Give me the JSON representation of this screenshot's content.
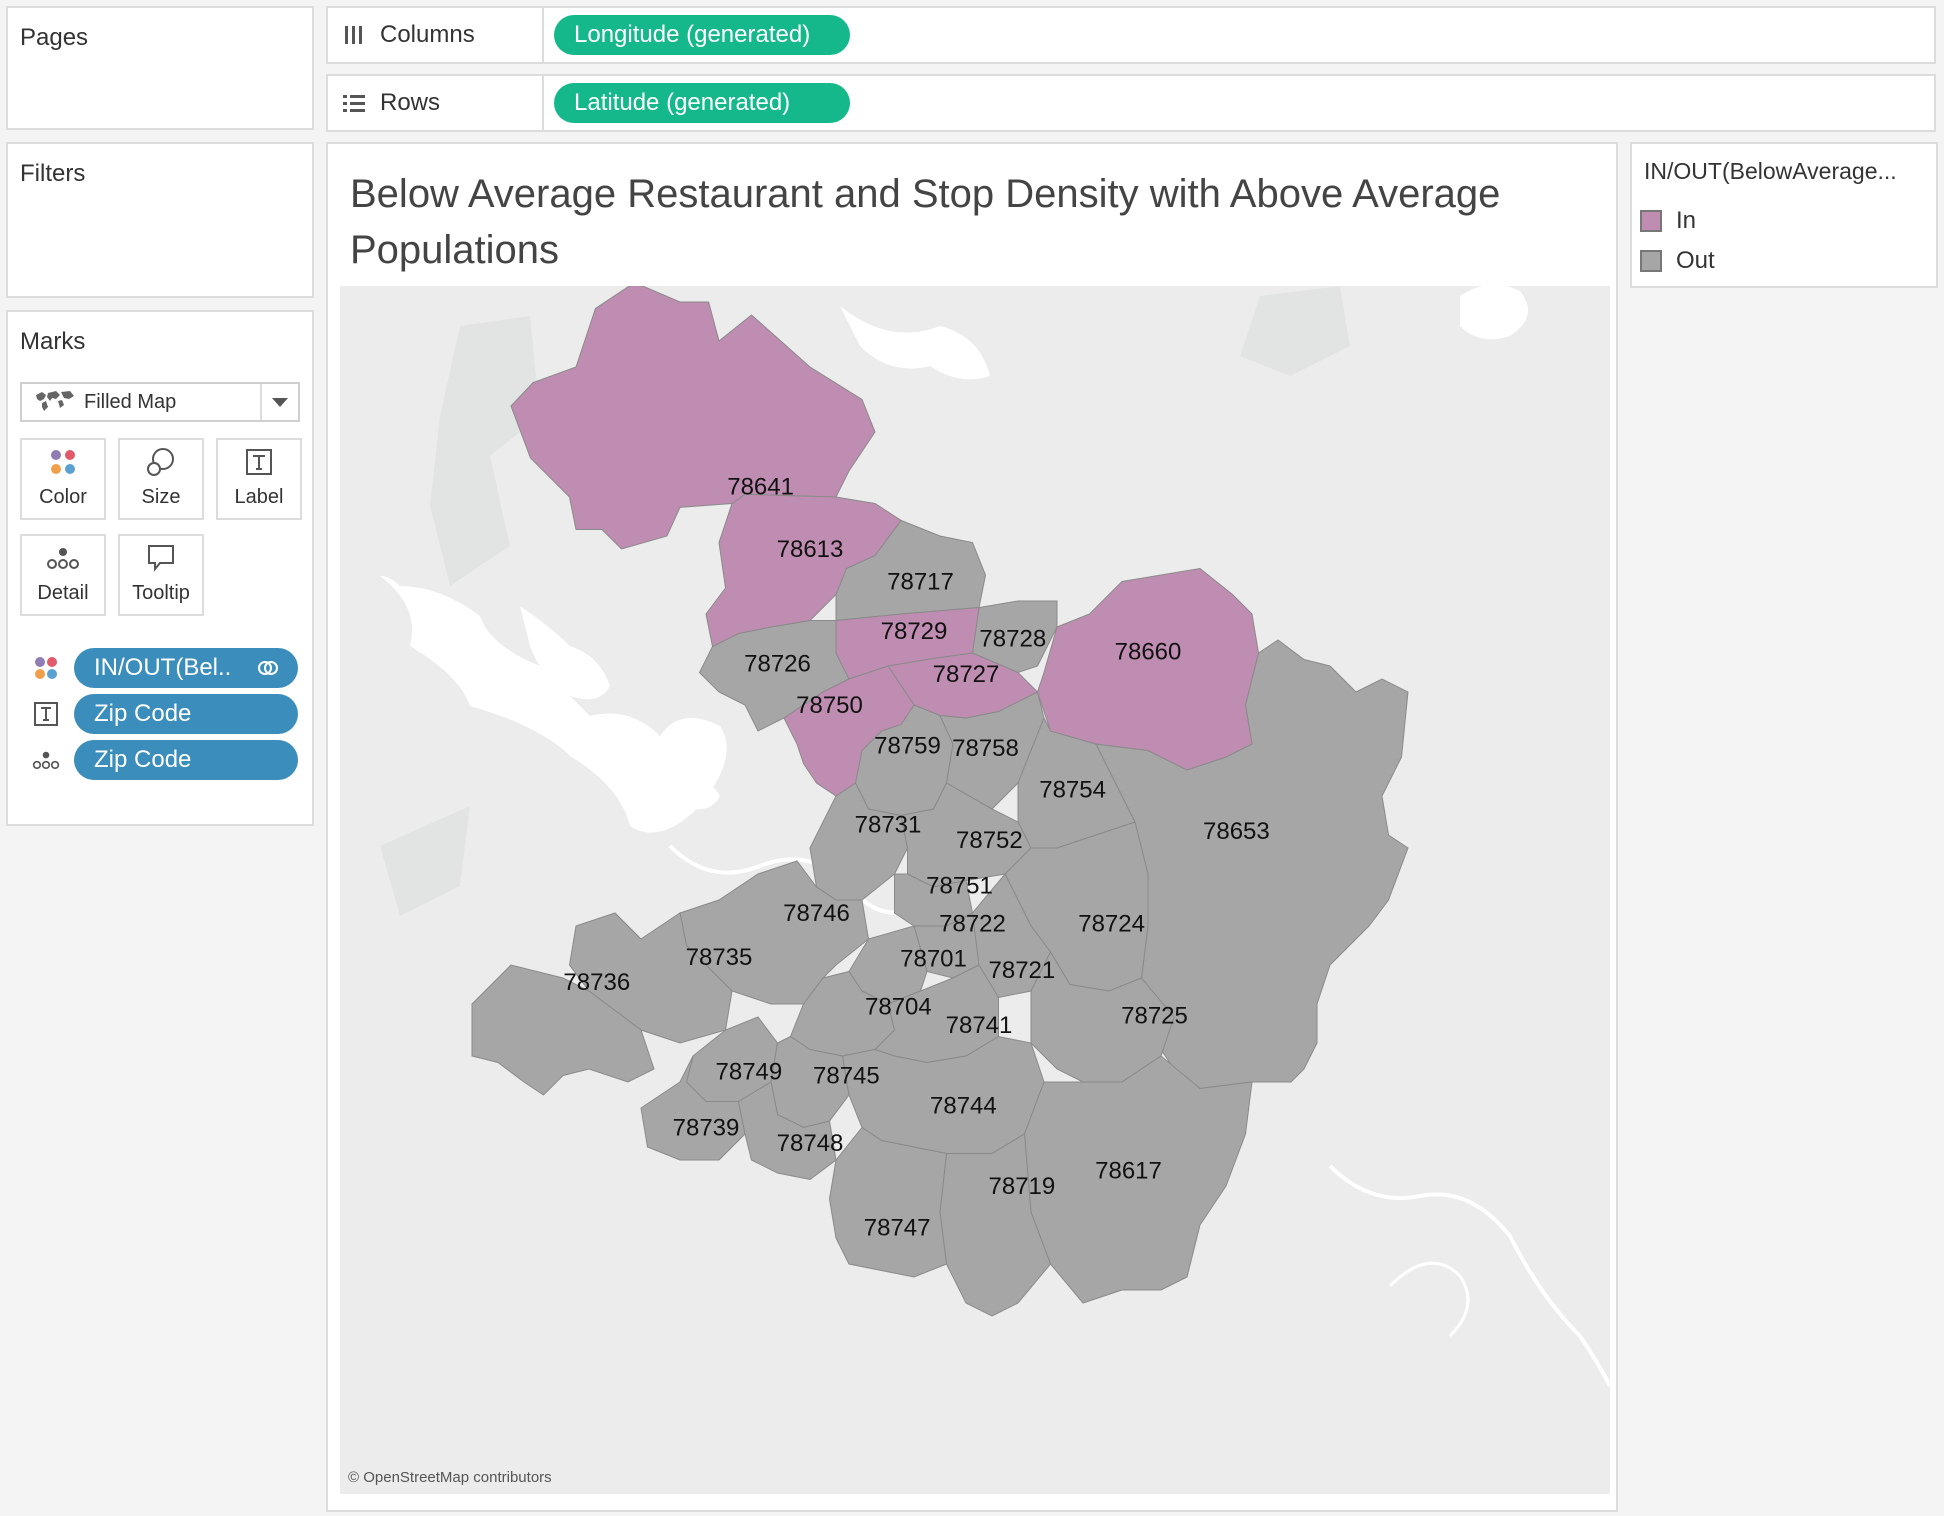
{
  "pages": {
    "title": "Pages"
  },
  "filters": {
    "title": "Filters"
  },
  "marks": {
    "title": "Marks",
    "mark_type": "Filled Map",
    "buttons": {
      "color": "Color",
      "size": "Size",
      "label": "Label",
      "detail": "Detail",
      "tooltip": "Tooltip"
    },
    "fields": [
      {
        "kind": "color",
        "label": "IN/OUT(Bel.."
      },
      {
        "kind": "label",
        "label": "Zip Code"
      },
      {
        "kind": "detail",
        "label": "Zip Code"
      }
    ]
  },
  "shelves": {
    "columns": {
      "label": "Columns",
      "pill": "Longitude (generated)"
    },
    "rows": {
      "label": "Rows",
      "pill": "Latitude (generated)"
    }
  },
  "view": {
    "title": "Below Average Restaurant and Stop Density with Above Average Populations",
    "attribution": "© OpenStreetMap contributors",
    "zip_codes": {
      "in": [
        "78641",
        "78613",
        "78729",
        "78727",
        "78750",
        "78660"
      ],
      "out": [
        "78717",
        "78728",
        "78726",
        "78759",
        "78758",
        "78754",
        "78653",
        "78731",
        "78752",
        "78751",
        "78746",
        "78722",
        "78724",
        "78735",
        "78701",
        "78721",
        "78736",
        "78704",
        "78741",
        "78725",
        "78749",
        "78745",
        "78744",
        "78739",
        "78748",
        "78617",
        "78719",
        "78747"
      ]
    }
  },
  "legend": {
    "title": "IN/OUT(BelowAverage...",
    "items": [
      {
        "label": "In",
        "color": "#bf8db2"
      },
      {
        "label": "Out",
        "color": "#a6a6a6"
      }
    ]
  },
  "colors": {
    "in": "#bf8db2",
    "out": "#a6a6a6",
    "pill_green": "#14b88a",
    "pill_blue": "#3b8dbb"
  }
}
